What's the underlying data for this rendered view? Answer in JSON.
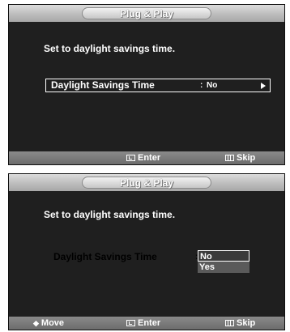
{
  "screen1": {
    "title": "Plug & Play",
    "instruction": "Set to daylight savings time.",
    "setting_label": "Daylight Savings Time",
    "setting_colon": ":",
    "setting_value": "No",
    "enter_label": "Enter",
    "skip_label": "Skip",
    "icons": {
      "enter": "enter-icon",
      "skip": "menu-icon",
      "arrow": "arrow-right-icon"
    }
  },
  "screen2": {
    "title": "Plug & Play",
    "instruction": "Set to daylight savings time.",
    "setting_label": "Daylight Savings Time",
    "setting_colon": ":",
    "options": [
      "No",
      "Yes"
    ],
    "selected_option": "No",
    "move_label": "Move",
    "enter_label": "Enter",
    "skip_label": "Skip",
    "icons": {
      "move": "up-down-arrow-icon",
      "enter": "enter-icon",
      "skip": "menu-icon"
    }
  },
  "colors": {
    "screen_bg": "#1f1f1f",
    "title_bar": "#bdbdbd",
    "bottom_bar": "#7a7a7a",
    "text": "#ffffff",
    "selected_option_bg": "#3a3a3a",
    "option_bg": "#5a5a5a"
  }
}
